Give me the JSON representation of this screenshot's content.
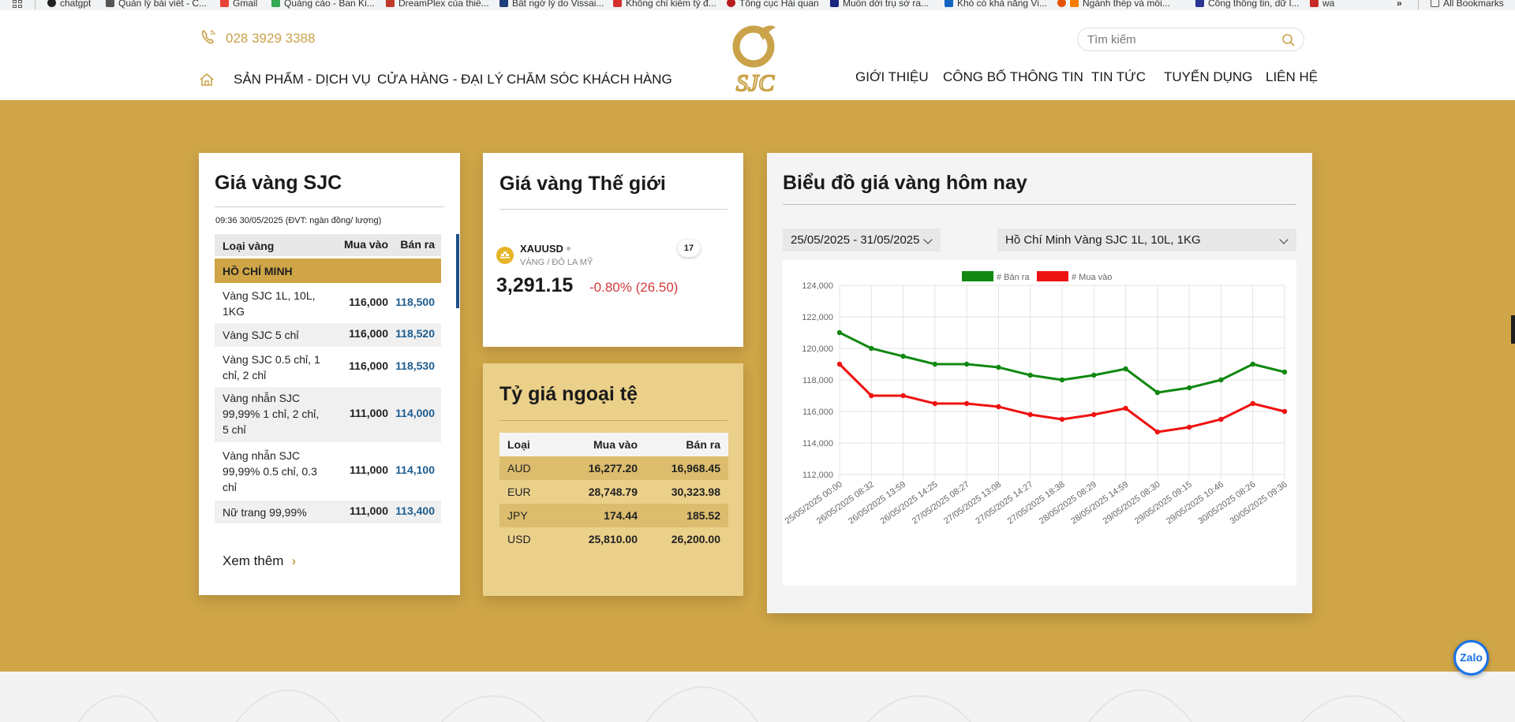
{
  "bookmarks": {
    "items": [
      "chatgpt",
      "Quản lý bài viết - C...",
      "Gmail",
      "Quảng cáo - Ban Ki...",
      "DreamPlex của thiế...",
      "Bất ngờ lý do Vissai...",
      "Không chỉ kiếm tỷ đ...",
      "Tổng cục Hải quan",
      "Muốn dời trụ sở ra...",
      "Khó có khả năng Vi...",
      "Ngành thép và mối...",
      "Cổng thông tin, dữ l...",
      "wa"
    ],
    "all": "All Bookmarks",
    "more": "»"
  },
  "header": {
    "phone": "028 3929 3388",
    "logo": "SJC",
    "search_placeholder": "Tìm kiếm",
    "nav_left": [
      "SẢN PHẨM - DỊCH VỤ",
      "CỬA HÀNG - ĐẠI LÝ",
      "CHĂM SÓC KHÁCH HÀNG"
    ],
    "nav_right": [
      "GIỚI THIỆU",
      "CÔNG BỐ THÔNG TIN",
      "TIN TỨC",
      "TUYỂN DỤNG",
      "LIÊN HỆ"
    ]
  },
  "sjc": {
    "title": "Giá vàng SJC",
    "timestamp": "09:36 30/05/2025 (ĐVT: ngàn đồng/ lượng)",
    "headers": [
      "Loại vàng",
      "Mua vào",
      "Bán ra"
    ],
    "region": "HỒ CHÍ MINH",
    "rows": [
      {
        "name": "Vàng SJC 1L, 10L, 1KG",
        "buy": "116,000",
        "sell": "118,500"
      },
      {
        "name": "Vàng SJC 5 chỉ",
        "buy": "116,000",
        "sell": "118,520"
      },
      {
        "name": "Vàng SJC 0.5 chỉ, 1 chỉ, 2 chỉ",
        "buy": "116,000",
        "sell": "118,530"
      },
      {
        "name": "Vàng nhẫn SJC 99,99% 1 chỉ, 2 chỉ, 5 chỉ",
        "buy": "111,000",
        "sell": "114,000"
      },
      {
        "name": "Vàng nhẫn SJC 99,99% 0.5 chỉ, 0.3 chỉ",
        "buy": "111,000",
        "sell": "114,100"
      },
      {
        "name": "Nữ trang 99,99%",
        "buy": "111,000",
        "sell": "113,400"
      }
    ],
    "more": "Xem thêm"
  },
  "world": {
    "title": "Giá vàng Thế giới",
    "symbol": "XAUUSD",
    "subtitle": "VÀNG / ĐÔ LA MỸ",
    "badge": "17",
    "price": "3,291.15",
    "change": "-0.80% (26.50)"
  },
  "fx": {
    "title": "Tỷ giá ngoại tệ",
    "headers": [
      "Loại",
      "Mua vào",
      "Bán ra"
    ],
    "rows": [
      {
        "code": "AUD",
        "buy": "16,277.20",
        "sell": "16,968.45"
      },
      {
        "code": "EUR",
        "buy": "28,748.79",
        "sell": "30,323.98"
      },
      {
        "code": "JPY",
        "buy": "174.44",
        "sell": "185.52"
      },
      {
        "code": "USD",
        "buy": "25,810.00",
        "sell": "26,200.00"
      }
    ]
  },
  "chart_card": {
    "title": "Biểu đồ giá vàng hôm nay",
    "date_range": "25/05/2025 - 31/05/2025",
    "product": "Hồ Chí Minh Vàng SJC 1L, 10L, 1KG"
  },
  "chart_data": {
    "type": "line",
    "x": [
      "25/05/2025 00:00",
      "26/05/2025 08:32",
      "26/05/2025 13:59",
      "26/05/2025 14:25",
      "27/05/2025 08:27",
      "27/05/2025 13:08",
      "27/05/2025 14:27",
      "27/05/2025 18:38",
      "28/05/2025 08:29",
      "28/05/2025 14:59",
      "29/05/2025 08:30",
      "29/05/2025 09:15",
      "29/05/2025 10:46",
      "30/05/2025 08:26",
      "30/05/2025 09:36"
    ],
    "series": [
      {
        "name": "# Bán ra",
        "color": "#118811",
        "values": [
          121000,
          120000,
          119500,
          119000,
          119000,
          118800,
          118300,
          118000,
          118300,
          118700,
          117200,
          117500,
          118000,
          119000,
          118500
        ]
      },
      {
        "name": "# Mua vào",
        "color": "#ee1111",
        "values": [
          119000,
          117000,
          117000,
          116500,
          116500,
          116300,
          115800,
          115500,
          115800,
          116200,
          114700,
          115000,
          115500,
          116500,
          116000
        ]
      }
    ],
    "yticks": [
      "124,000",
      "122,000",
      "120,000",
      "118,000",
      "116,000",
      "114,000",
      "112,000"
    ],
    "ylim": [
      112000,
      124000
    ],
    "grid": true,
    "legend": "top-center"
  },
  "zalo": "Zalo"
}
